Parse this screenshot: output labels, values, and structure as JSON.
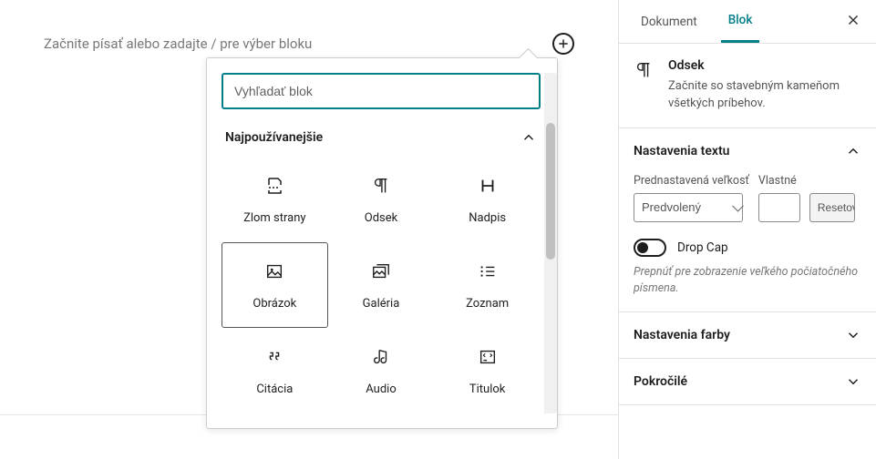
{
  "editor": {
    "placeholder": "Začnite písať alebo zadajte / pre výber bloku"
  },
  "inserter": {
    "search_placeholder": "Vyhľadať blok",
    "category_title": "Najpoužívanejšie",
    "blocks": [
      {
        "label": "Zlom strany",
        "icon": "page-break"
      },
      {
        "label": "Odsek",
        "icon": "paragraph"
      },
      {
        "label": "Nadpis",
        "icon": "heading"
      },
      {
        "label": "Obrázok",
        "icon": "image",
        "selected": true
      },
      {
        "label": "Galéria",
        "icon": "gallery"
      },
      {
        "label": "Zoznam",
        "icon": "list"
      },
      {
        "label": "Citácia",
        "icon": "quote"
      },
      {
        "label": "Audio",
        "icon": "audio"
      },
      {
        "label": "Titulok",
        "icon": "caption"
      }
    ]
  },
  "sidebar": {
    "tabs": {
      "document": "Dokument",
      "block": "Blok"
    },
    "block_info": {
      "title": "Odsek",
      "description": "Začnite so stavebným kameňom všetkých príbehov."
    },
    "text_settings": {
      "title": "Nastavenia textu",
      "preset_label": "Prednastavená veľkosť",
      "custom_label": "Vlastné",
      "preset_value": "Predvolený",
      "reset": "Resetovať",
      "dropcap_label": "Drop Cap",
      "dropcap_help": "Prepnúť pre zobrazenie veľkého počiatočného písmena."
    },
    "color_settings": {
      "title": "Nastavenia farby"
    },
    "advanced": {
      "title": "Pokročilé"
    }
  }
}
